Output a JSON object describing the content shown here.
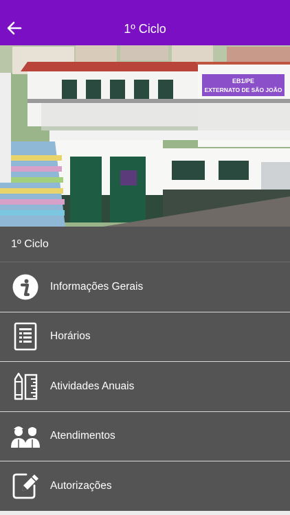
{
  "header": {
    "title": "1º Ciclo",
    "back_icon": "arrow-left-icon"
  },
  "hero": {
    "sign_line1": "EB1/PE",
    "sign_line2": "EXTERNATO DE SÃO JOÃO"
  },
  "section": {
    "title": "1º Ciclo"
  },
  "menu": {
    "items": [
      {
        "label": "Informações Gerais",
        "icon": "info-icon"
      },
      {
        "label": "Horários",
        "icon": "schedule-document-icon"
      },
      {
        "label": "Atividades Anuais",
        "icon": "ruler-pencil-icon"
      },
      {
        "label": "Atendimentos",
        "icon": "people-icon"
      },
      {
        "label": "Autorizações",
        "icon": "edit-document-icon"
      }
    ]
  },
  "colors": {
    "topbar": "#7a0fc4",
    "menu_bg": "#545454",
    "divider": "#d9d9d9"
  }
}
